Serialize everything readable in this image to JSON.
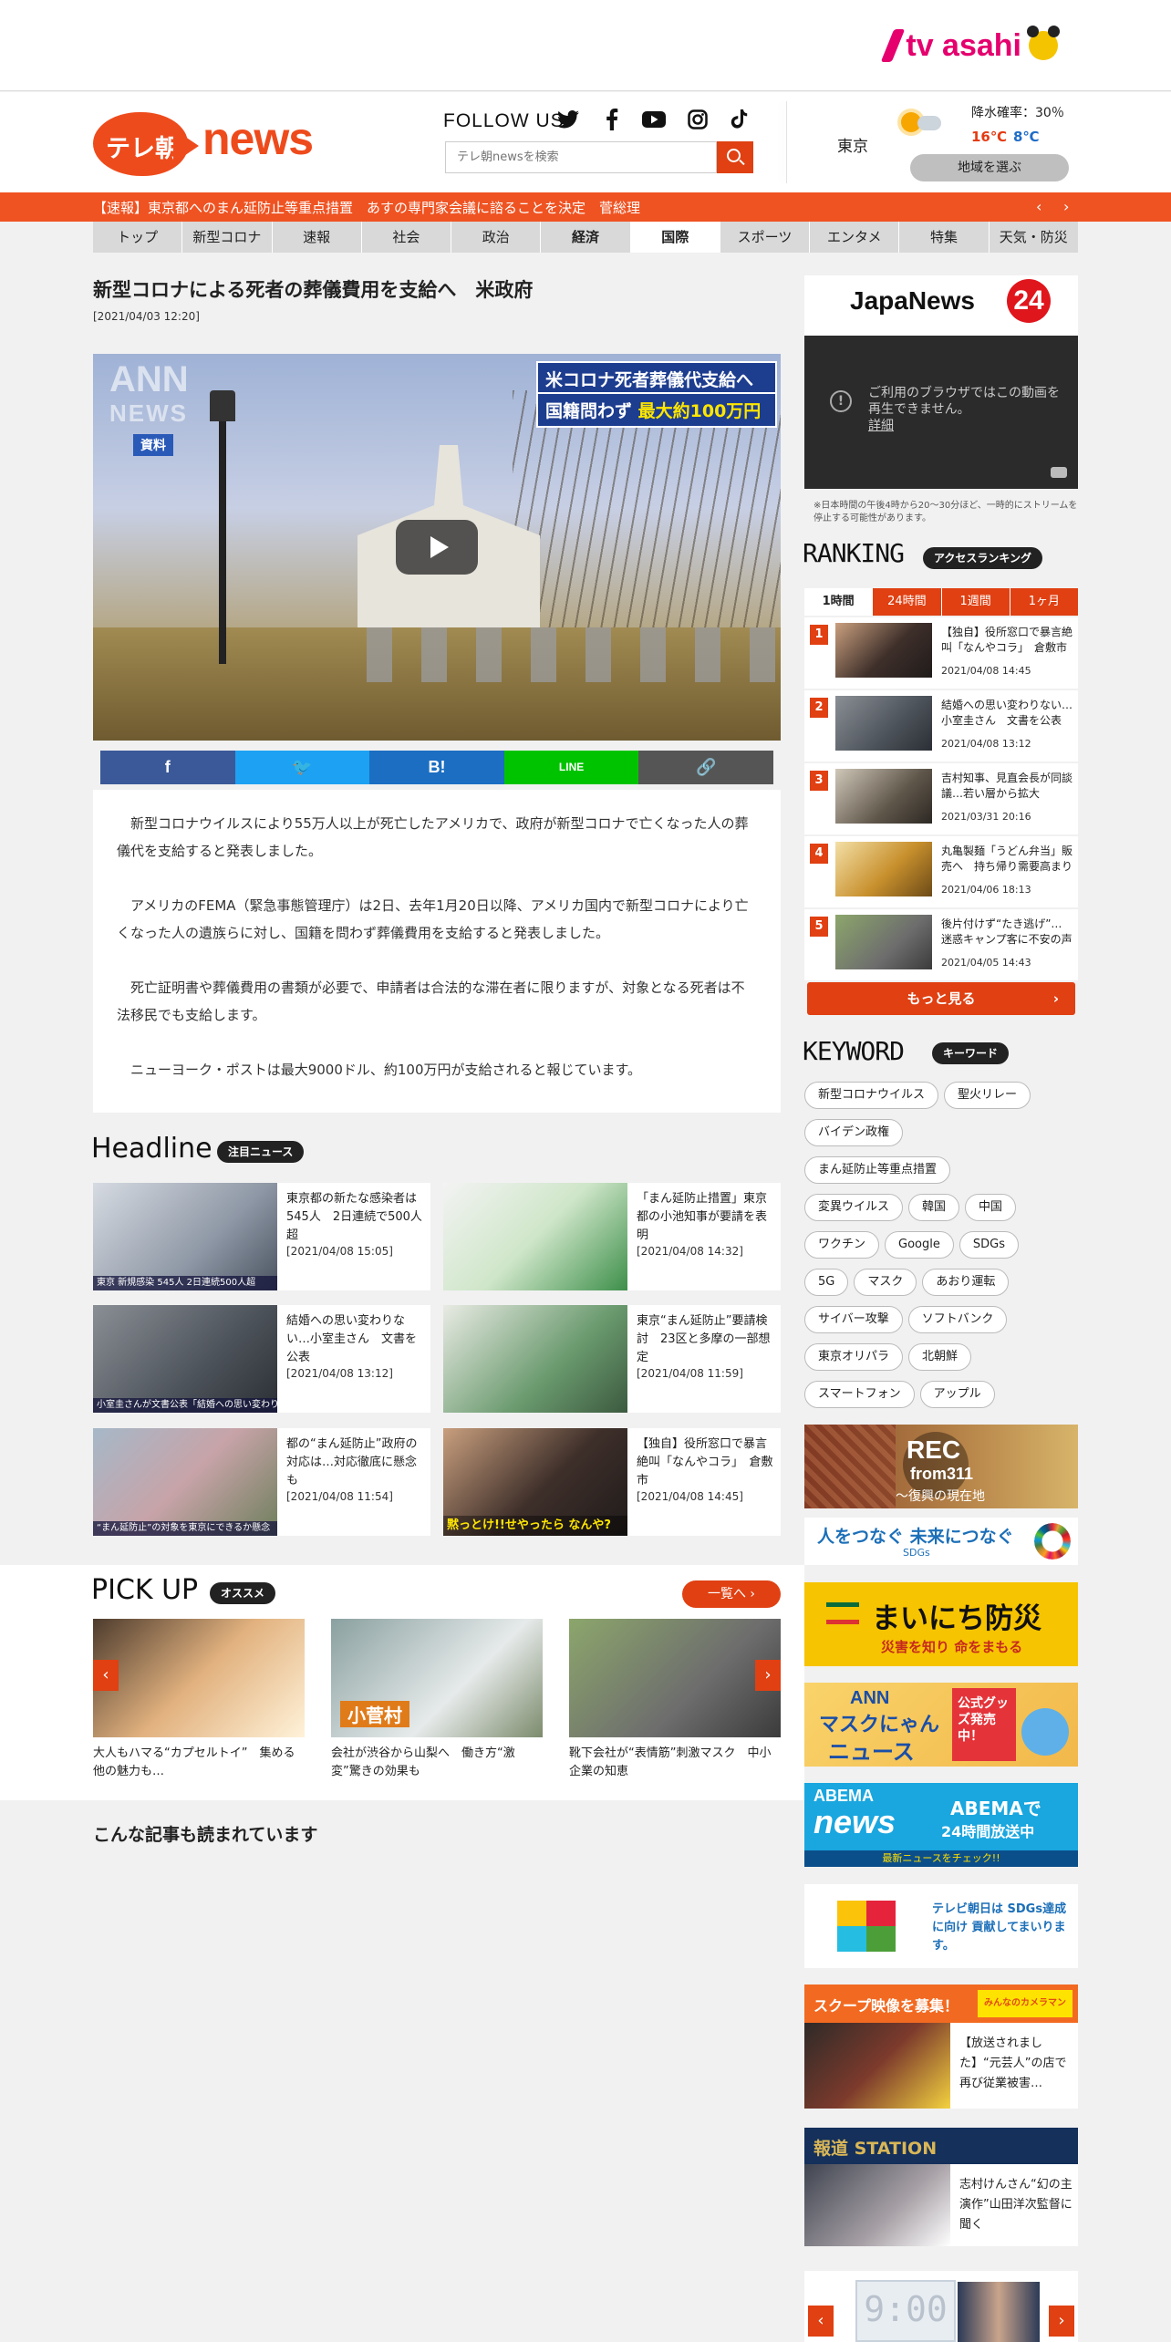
{
  "brand": {
    "corporate": "tv asahi",
    "news_logo_left": "テレ朝",
    "news_logo_right": "news"
  },
  "header": {
    "follow_label": "FOLLOW US",
    "social": [
      "twitter-icon",
      "facebook-icon",
      "youtube-icon",
      "instagram-icon",
      "tiktok-icon"
    ],
    "search_placeholder": "テレ朝newsを検索",
    "weather": {
      "city": "東京",
      "rain_label": "降水確率：30％",
      "high": "16℃",
      "low": "8℃",
      "region_button": "地域を選ぶ"
    }
  },
  "ticker": {
    "text": "【速報】東京都へのまん延防止等重点措置　あすの専門家会議に諮ることを決定　菅総理",
    "prev": "‹",
    "next": "›"
  },
  "nav": {
    "items": [
      "トップ",
      "新型コロナ",
      "速報",
      "社会",
      "政治",
      "経済",
      "国際",
      "スポーツ",
      "エンタメ",
      "特集",
      "天気・防災"
    ],
    "active": "国際"
  },
  "article": {
    "title": "新型コロナによる死者の葬儀費用を支給へ　米政府",
    "date": "[2021/04/03 12:20]",
    "video": {
      "watermark": "ANN",
      "watermark_sub": "NEWS",
      "tag": "資料",
      "caption_line1": "米コロナ死者葬儀代支給へ",
      "caption_line2_a": "国籍問わず",
      "caption_line2_b": "最大約100万円"
    },
    "share": [
      {
        "label": "f",
        "color": "#3b5998",
        "name": "facebook"
      },
      {
        "label": "🐦",
        "color": "#1da1f2",
        "name": "twitter"
      },
      {
        "label": "B!",
        "color": "#1b6ec2",
        "name": "hatena"
      },
      {
        "label": "LINE",
        "color": "#00c300",
        "name": "line"
      },
      {
        "label": "🔗",
        "color": "#555555",
        "name": "copy-link"
      }
    ],
    "paragraphs": [
      "新型コロナウイルスにより55万人以上が死亡したアメリカで、政府が新型コロナで亡くなった人の葬儀代を支給すると発表しました。",
      "アメリカのFEMA（緊急事態管理庁）は2日、去年1月20日以降、アメリカ国内で新型コロナにより亡くなった人の遺族らに対し、国籍を問わず葬儀費用を支給すると発表しました。",
      "死亡証明書や葬儀費用の書類が必要で、申請者は合法的な滞在者に限りますが、対象となる死者は不法移民でも支給します。",
      "ニューヨーク・ポストは最大9000ドル、約100万円が支給されると報じています。"
    ]
  },
  "headline": {
    "title": "Headline",
    "tag": "注目ニュース",
    "items": [
      {
        "title": "東京都の新たな感染者は545人　2日連続で500人超",
        "date": "[2021/04/08 15:05]",
        "strip": "東京 新規感染 545人 2日連続500人超"
      },
      {
        "title": "「まん延防止措置」東京都の小池知事が要請を表明",
        "date": "[2021/04/08 14:32]",
        "strip": ""
      },
      {
        "title": "結婚への思い変わりない…小室圭さん　文書を公表",
        "date": "[2021/04/08 13:12]",
        "strip": "小室圭さんが文書公表「結婚への思い変わりない」"
      },
      {
        "title": "東京“まん延防止”要請検討　23区と多摩の一部想定",
        "date": "[2021/04/08 11:59]",
        "strip": ""
      },
      {
        "title": "都の“まん延防止”政府の対応は…対応徹底に懸念も",
        "date": "[2021/04/08 11:54]",
        "strip": "“まん延防止”の対象を東京にできるか懸念"
      },
      {
        "title": "【独自】役所窓口で暴言絶叫「なんやコラ」　倉敷市",
        "date": "[2021/04/08 14:45]",
        "strip": "黙っとけ!!せやったら なんや?"
      }
    ]
  },
  "pickup": {
    "title": "PICK UP",
    "tag": "オススメ",
    "more": "一覧へ",
    "items": [
      {
        "title": "大人もハマる“カプセルトイ”　集める他の魅力も…"
      },
      {
        "title": "会社が渋谷から山梨へ　働き方“激変”驚きの効果も",
        "overlay": "小菅村"
      },
      {
        "title": "靴下会社が“表情筋”刺激マスク　中小企業の知恵"
      }
    ]
  },
  "related_title": "こんな記事も読まれています",
  "japanews": {
    "logo": "JapaNews",
    "num": "24",
    "message": "ご利用のブラウザではこの動画を再生できません。",
    "more": "詳細",
    "note": "※日本時間の午後4時から20～30分ほど、一時的にストリームを停止する可能性があります。"
  },
  "ranking": {
    "title": "RANKING",
    "tag": "アクセスランキング",
    "tabs": [
      "1時間",
      "24時間",
      "1週間",
      "1ヶ月"
    ],
    "active": "1時間",
    "items": [
      {
        "rank": "1",
        "title": "【独自】役所窓口で暴言絶叫「なんやコラ」　倉敷市",
        "date": "2021/04/08 14:45"
      },
      {
        "rank": "2",
        "title": "結婚への思い変わりない…小室圭さん　文書を公表",
        "date": "2021/04/08 13:12"
      },
      {
        "rank": "3",
        "title": "吉村知事、見直会長が同談議…若い層から拡大",
        "date": "2021/03/31 20:16"
      },
      {
        "rank": "4",
        "title": "丸亀製麺「うどん弁当」販売へ　持ち帰り需要高まり",
        "date": "2021/04/06 18:13"
      },
      {
        "rank": "5",
        "title": "後片付けず“たき逃げ”…迷惑キャンプ客に不安の声",
        "date": "2021/04/05 14:43"
      }
    ],
    "more": "もっと見る"
  },
  "keyword": {
    "title": "KEYWORD",
    "tag": "キーワード",
    "items": [
      "新型コロナウイルス",
      "聖火リレー",
      "バイデン政権",
      "まん延防止等重点措置",
      "変異ウイルス",
      "韓国",
      "中国",
      "ワクチン",
      "Google",
      "SDGs",
      "5G",
      "マスク",
      "あおり運転",
      "サイバー攻撃",
      "ソフトバンク",
      "東京オリパラ",
      "北朝鮮",
      "スマートフォン",
      "アップル"
    ]
  },
  "banners": {
    "rec": {
      "main": "REC",
      "sub": "from311",
      "caption": "～復興の現在地"
    },
    "sdgs": {
      "main": "人をつなぐ 未来につなぐ",
      "sub": "SDGs"
    },
    "bousai": {
      "main": "まいにち防災",
      "sub": "災害を知り 命をまもる"
    },
    "mask": {
      "line1": "ANN",
      "line2": "マスクにゃん",
      "line3": "ニュース",
      "badge": "公式グッズ発売中！"
    },
    "abema": {
      "logo1": "ABEMA",
      "logo2": "news",
      "text1": "ABEMAで",
      "text2": "24時間放送中",
      "foot": "最新ニュースをチェック!!"
    },
    "sdgs2": {
      "text": "テレビ朝日は SDGs達成に向け 貢献してまいります。"
    },
    "scoop": {
      "head": "スクープ映像を募集！",
      "brand": "みんなのカメラマン",
      "title": "【放送されました】“元芸人”の店で再び従業被害…"
    },
    "hodo": {
      "head": "報道 STATION",
      "title": "志村けんさん“幻の主演作”山田洋次監督に聞く"
    },
    "bottom": {
      "clock": "9:00"
    }
  }
}
